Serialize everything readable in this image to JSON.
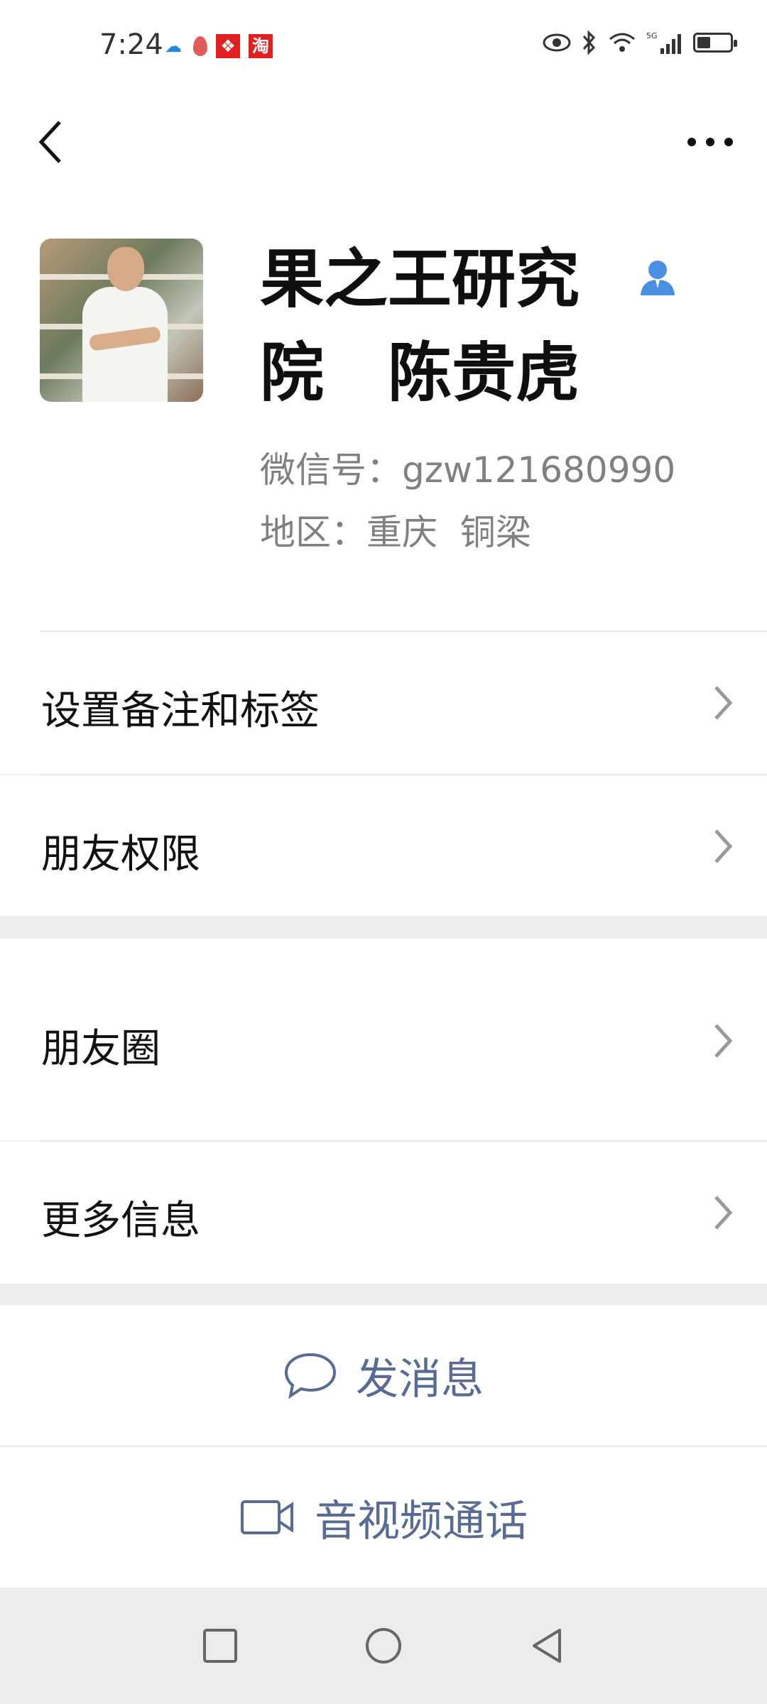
{
  "status_bar": {
    "time": "7:24",
    "left_icons": [
      "cloud-icon",
      "drop-icon",
      "app-red-icon",
      "taobao-icon"
    ],
    "taobao_glyph": "淘",
    "right_icons": [
      "eye-icon",
      "bluetooth-icon",
      "wifi-icon",
      "signal-5g-icon",
      "battery-icon"
    ],
    "network": "5G",
    "battery_level": 0.35
  },
  "nav": {
    "back_icon": "back-chevron-icon",
    "more_icon": "more-dots-icon"
  },
  "profile": {
    "name_line1": "果之王研究",
    "name_line2": "院　陈贵虎",
    "wechat_id": "微信号：gzw121680990",
    "region": "地区：重庆  铜梁",
    "badge_color": "#4a90e2"
  },
  "menu": {
    "remark": "设置备注和标签",
    "permission": "朋友权限",
    "moments": "朋友圈",
    "more_info": "更多信息"
  },
  "actions": {
    "message": "发消息",
    "call": "音视频通话",
    "accent": "#576b95"
  }
}
